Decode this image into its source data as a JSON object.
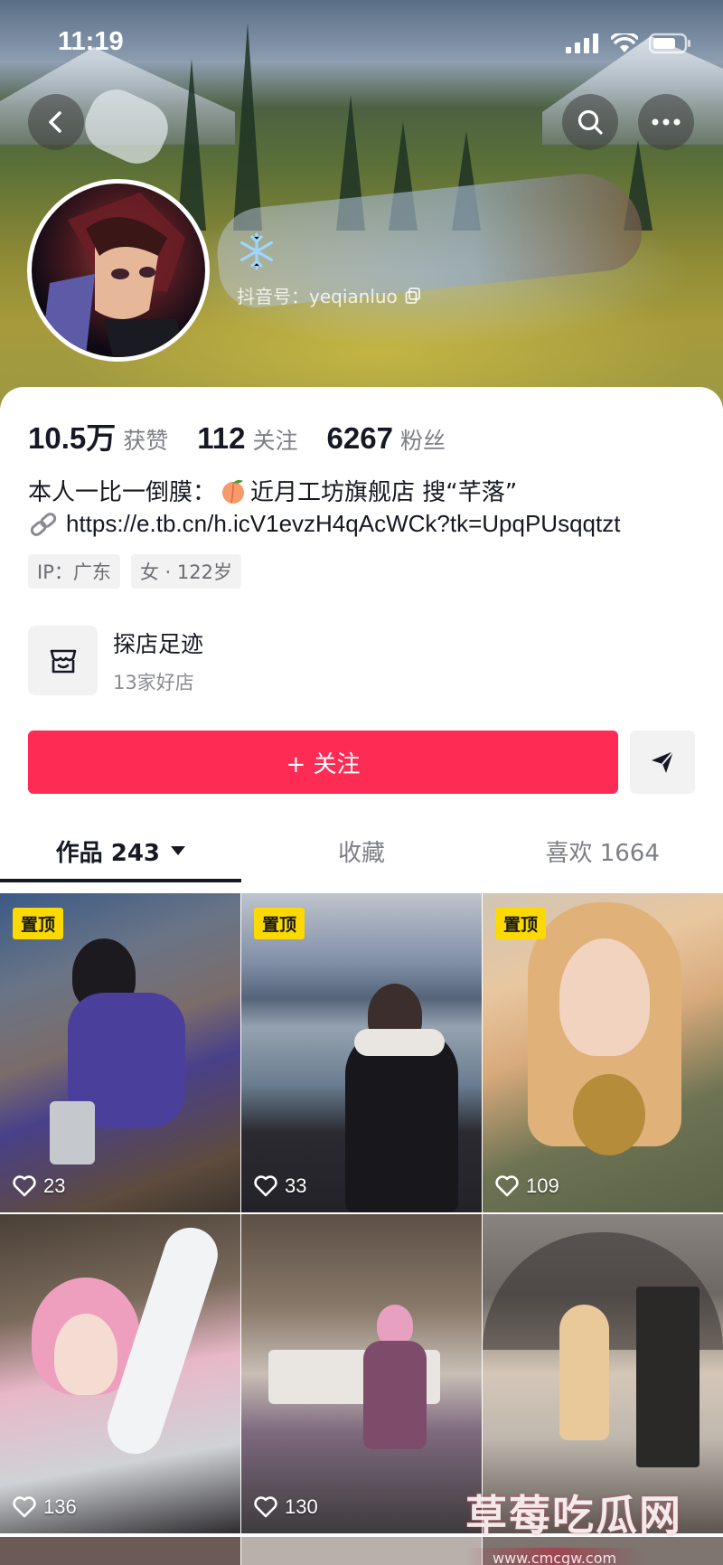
{
  "status_bar": {
    "time": "11:19"
  },
  "profile": {
    "emoji": "❄️",
    "douyin_id": "抖音号：yeqianluo",
    "stats": [
      {
        "value": "10.5万",
        "label": "获赞"
      },
      {
        "value": "112",
        "label": "关注"
      },
      {
        "value": "6267",
        "label": "粉丝"
      }
    ],
    "bio_line1_prefix": "本人一比一倒膜：",
    "bio_line1_suffix": "近月工坊旗舰店 搜“芊落”",
    "bio_link": "https://e.tb.cn/h.icV1evzH4qAcWCk?tk=UpqPUsqqtzt",
    "tags": [
      "IP：广东",
      "女 · 122岁"
    ],
    "shop": {
      "title": "探店足迹",
      "subtitle": "13家好店"
    },
    "follow_label": "+ 关注"
  },
  "tabs": [
    {
      "label": "作品 243",
      "active": true
    },
    {
      "label": "收藏",
      "active": false
    },
    {
      "label": "喜欢 1664",
      "active": false
    }
  ],
  "videos": [
    {
      "pinned": true,
      "pin_label": "置顶",
      "likes": "23"
    },
    {
      "pinned": true,
      "pin_label": "置顶",
      "likes": "33"
    },
    {
      "pinned": true,
      "pin_label": "置顶",
      "likes": "109"
    },
    {
      "pinned": false,
      "likes": "136"
    },
    {
      "pinned": false,
      "likes": "130"
    },
    {
      "pinned": false,
      "likes": ""
    }
  ],
  "watermark": {
    "title": "草莓吃瓜网",
    "url": "www.cmcgw.com"
  },
  "colors": {
    "accent": "#fe2c55",
    "pin": "#fcd900"
  }
}
